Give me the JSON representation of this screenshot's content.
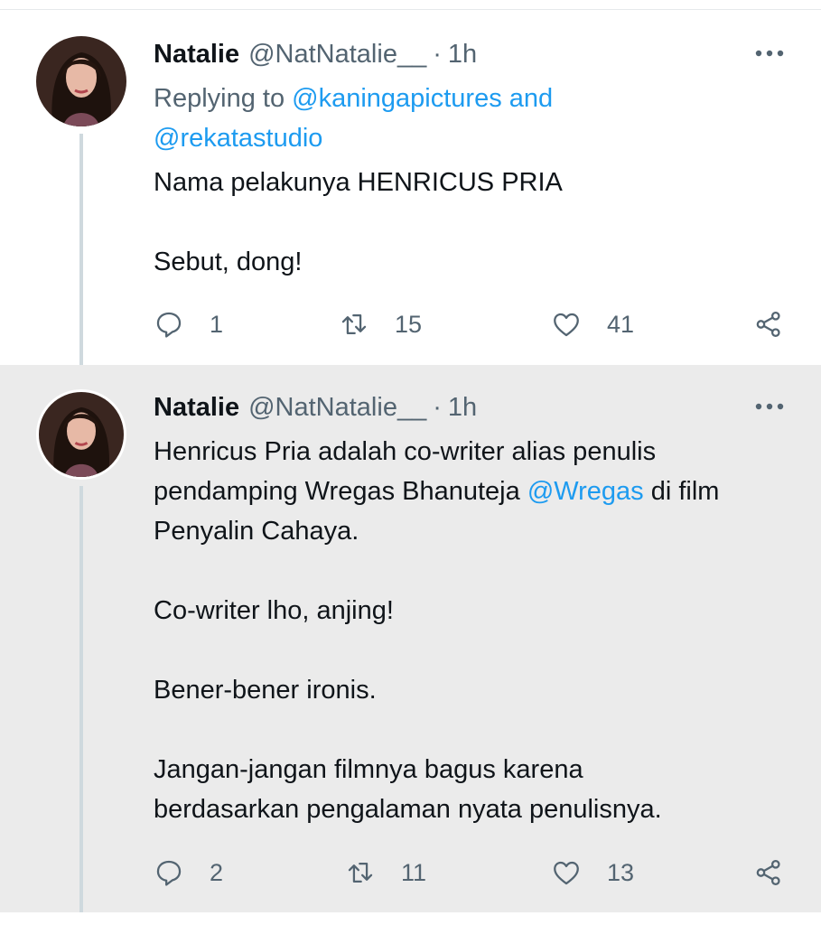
{
  "tweets": [
    {
      "name": "Natalie",
      "handle": "@NatNatalie__",
      "separator": "·",
      "time": "1h",
      "replying": {
        "prefix": "Replying to",
        "mention1": "@kaningapictures",
        "conjunction": "and",
        "mention2": "@rekatastudio"
      },
      "body": [
        "Nama pelakunya HENRICUS PRIA",
        "Sebut, dong!"
      ],
      "stats": {
        "replies": "1",
        "retweets": "15",
        "likes": "41"
      }
    },
    {
      "name": "Natalie",
      "handle": "@NatNatalie__",
      "separator": "·",
      "time": "1h",
      "body": {
        "p1_line1": "Henricus Pria adalah co-writer alias penulis",
        "p1_line2_before": "pendamping Wregas Bhanuteja",
        "p1_mention": "@Wregas",
        "p1_line2_after": "di film",
        "p1_line3": "Penyalin Cahaya.",
        "p2": "Co-writer lho, anjing!",
        "p3": "Bener-bener ironis.",
        "p4_line1": "Jangan-jangan filmnya bagus karena",
        "p4_line2": "berdasarkan pengalaman nyata penulisnya."
      },
      "stats": {
        "replies": "2",
        "retweets": "11",
        "likes": "13"
      }
    }
  ],
  "icons": {
    "more": "more-horizontal-icon",
    "reply": "speech-bubble-icon",
    "retweet": "retweet-icon",
    "like": "heart-icon",
    "share": "share-icon"
  },
  "colors": {
    "link": "#1d9bf0",
    "secondary_text": "#536471",
    "primary_text": "#0f1419",
    "thread_line": "#cfd9de",
    "highlight_background": "#ebebeb"
  }
}
